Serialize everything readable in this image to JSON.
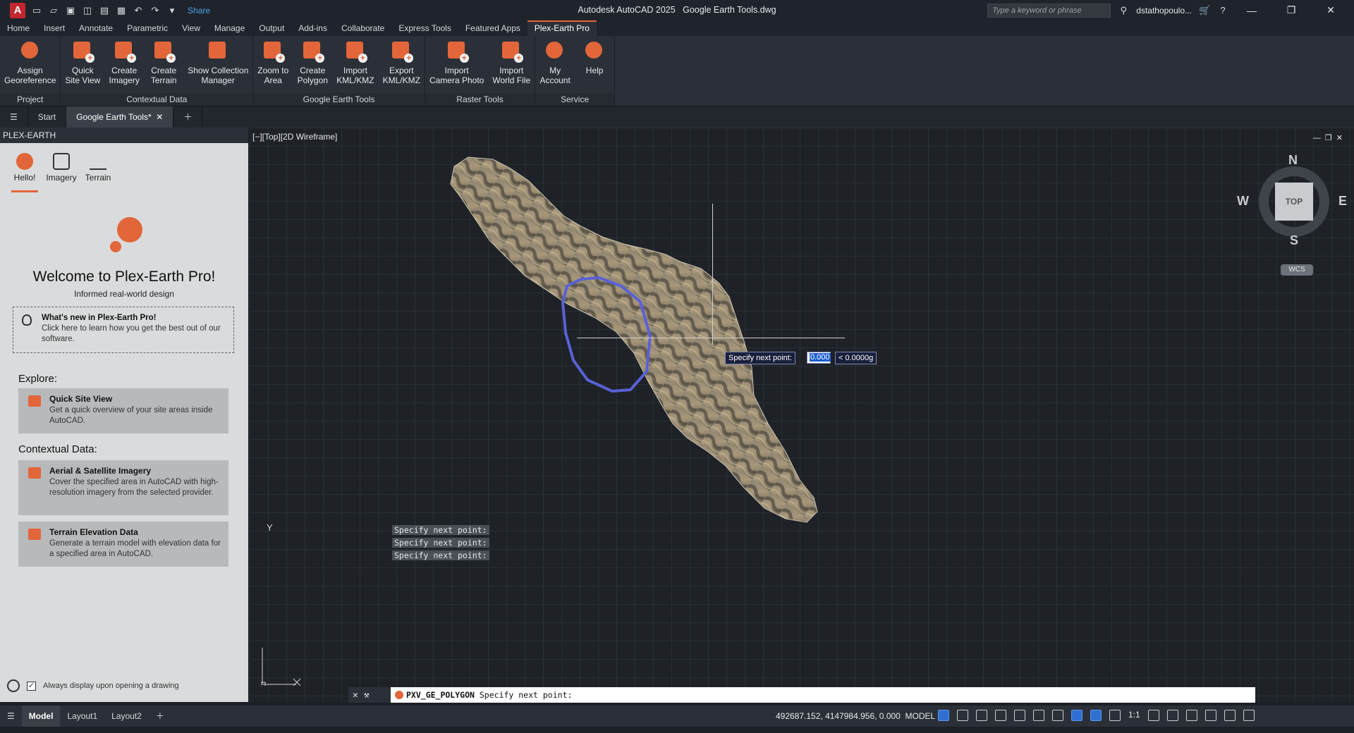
{
  "app": {
    "logo_letter": "A",
    "title": "Autodesk AutoCAD 2025",
    "document": "Google Earth Tools.dwg",
    "share_label": "Share",
    "search_placeholder": "Type a keyword or phrase",
    "user": "dstathopoulo...",
    "accent_color": "#e2663a"
  },
  "ribbon_tabs": [
    "Home",
    "Insert",
    "Annotate",
    "Parametric",
    "View",
    "Manage",
    "Output",
    "Add-ins",
    "Collaborate",
    "Express Tools",
    "Featured Apps",
    "Plex-Earth Pro"
  ],
  "ribbon": {
    "panels": [
      {
        "title": "Project",
        "buttons": [
          {
            "label": "Assign\nGeoreference",
            "icon": "georeference-icon"
          }
        ]
      },
      {
        "title": "Contextual Data",
        "buttons": [
          {
            "label": "Quick\nSite View",
            "icon": "quick-site-view-icon"
          },
          {
            "label": "Create\nImagery",
            "icon": "create-imagery-icon"
          },
          {
            "label": "Create\nTerrain",
            "icon": "create-terrain-icon"
          },
          {
            "label": "Show Collection\nManager",
            "icon": "collection-manager-icon"
          }
        ]
      },
      {
        "title": "Google Earth Tools",
        "buttons": [
          {
            "label": "Zoom to\nArea",
            "icon": "zoom-to-area-icon"
          },
          {
            "label": "Create\nPolygon",
            "icon": "create-polygon-icon"
          },
          {
            "label": "Import\nKML/KMZ",
            "icon": "import-kml-icon"
          },
          {
            "label": "Export\nKML/KMZ",
            "icon": "export-kml-icon"
          }
        ]
      },
      {
        "title": "Raster Tools",
        "buttons": [
          {
            "label": "Import\nCamera Photo",
            "icon": "camera-photo-icon"
          },
          {
            "label": "Import\nWorld File",
            "icon": "world-file-icon"
          }
        ]
      },
      {
        "title": "Service",
        "buttons": [
          {
            "label": "My\nAccount",
            "icon": "account-icon"
          },
          {
            "label": "Help",
            "icon": "help-icon"
          }
        ]
      }
    ]
  },
  "doc_tabs": {
    "start": "Start",
    "active": "Google Earth Tools*"
  },
  "sidepanel": {
    "header": "PLEX-EARTH",
    "tabs": [
      "Hello!",
      "Imagery",
      "Terrain"
    ],
    "welcome_title": "Welcome to Plex-Earth Pro!",
    "welcome_sub": "Informed real-world design",
    "whats_new_title": "What's new in Plex-Earth Pro!",
    "whats_new_body": "Click here to learn how you get the best out of our software.",
    "explore_heading": "Explore:",
    "contextual_heading": "Contextual Data:",
    "cards": [
      {
        "title": "Quick Site View",
        "body": "Get a quick overview of your site areas inside AutoCAD."
      },
      {
        "title": "Aerial & Satellite Imagery",
        "body": "Cover the specified area in AutoCAD with high-resolution imagery from the selected provider."
      },
      {
        "title": "Terrain Elevation Data",
        "body": "Generate a terrain model with elevation data for a specified area in AutoCAD."
      }
    ],
    "always_display": "Always display upon opening a drawing"
  },
  "viewport": {
    "label": "[−][Top][2D Wireframe]",
    "viewcube": {
      "top": "TOP",
      "n": "N",
      "s": "S",
      "e": "E",
      "w": "W",
      "wcs": "WCS"
    },
    "tooltip": "Specify next point:",
    "input_value": "0.000",
    "angle_value": "< 0.0000g",
    "ucs_y": "Y",
    "history": [
      "Specify next point:",
      "Specify next point:",
      "Specify next point:"
    ],
    "command": "PXV_GE_POLYGON",
    "command_prompt": "Specify next point:"
  },
  "statusbar": {
    "tabs": [
      "Model",
      "Layout1",
      "Layout2"
    ],
    "coords": "492687.152, 4147984.956, 0.000",
    "model_label": "MODEL",
    "scale": "1:1"
  }
}
